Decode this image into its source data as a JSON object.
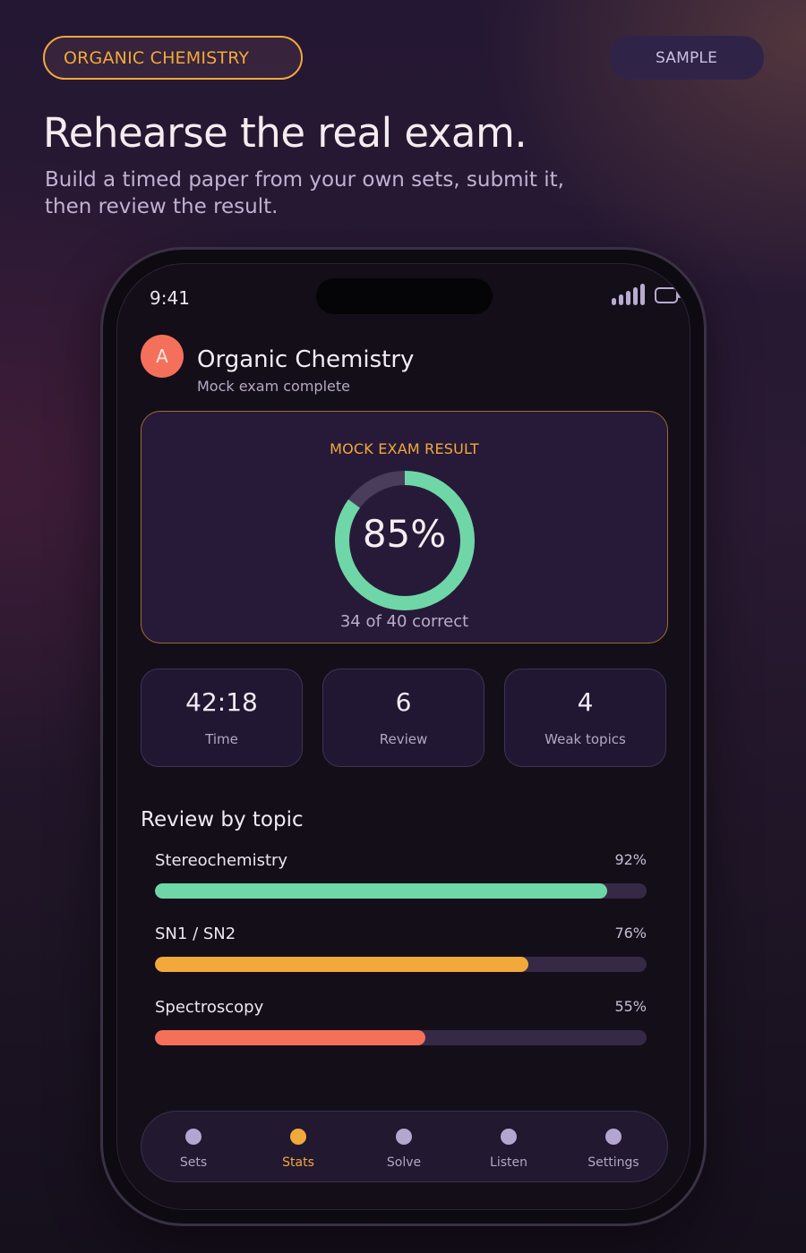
{
  "header": {
    "topic_pill": "ORGANIC CHEMISTRY",
    "sample_pill": "SAMPLE",
    "headline": "Rehearse the real exam.",
    "subhead": "Build a timed paper from your own sets, submit it, then review the result."
  },
  "status_bar": {
    "time": "9:41",
    "icons": [
      "signal-icon",
      "battery-icon"
    ]
  },
  "app": {
    "avatar_letter": "A",
    "title": "Organic Chemistry",
    "subtitle": "Mock exam complete"
  },
  "result": {
    "label": "MOCK EXAM RESULT",
    "score_text": "85%",
    "score_fraction": 0.85,
    "correct_text": "34 of 40 correct",
    "ring_color": "#6fd6a8"
  },
  "stats": [
    {
      "value": "42:18",
      "label": "Time"
    },
    {
      "value": "6",
      "label": "Review"
    },
    {
      "value": "4",
      "label": "Weak topics"
    }
  ],
  "review": {
    "title": "Review by topic",
    "topics": [
      {
        "name": "Stereochemistry",
        "pct_text": "92%",
        "fraction": 0.92,
        "color": "#6fd6a8"
      },
      {
        "name": "SN1 / SN2",
        "pct_text": "76%",
        "fraction": 0.76,
        "color": "#f2a93b"
      },
      {
        "name": "Spectroscopy",
        "pct_text": "55%",
        "fraction": 0.55,
        "color": "#f5705a"
      }
    ]
  },
  "nav": {
    "active_index": 1,
    "items": [
      {
        "label": "Sets"
      },
      {
        "label": "Stats"
      },
      {
        "label": "Solve"
      },
      {
        "label": "Listen"
      },
      {
        "label": "Settings"
      }
    ]
  },
  "colors": {
    "accent": "#f2a93b",
    "success": "#6fd6a8",
    "danger": "#f5705a"
  }
}
